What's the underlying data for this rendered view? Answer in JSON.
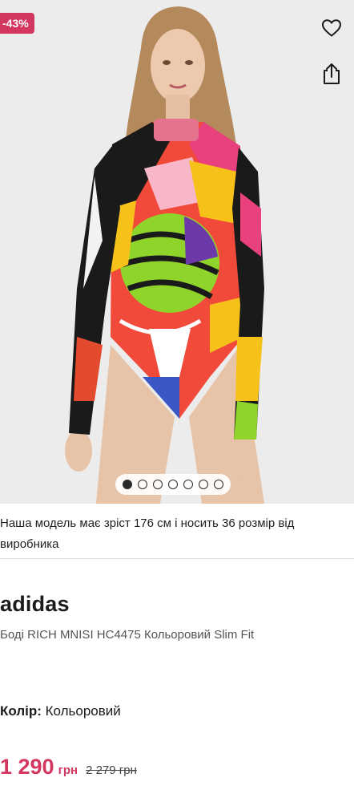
{
  "product": {
    "discount": "-43%",
    "gallery": {
      "slides": 7,
      "active_index": 0
    },
    "model_note": "Наша модель має зріст 176 см і носить 36 розмір від виробника",
    "brand": "adidas",
    "name": "Боді RICH MNISI HC4475 Кольоровий Slim Fit",
    "color_label": "Колір:",
    "color_value": "Кольоровий",
    "price_current": "1 290",
    "price_currency": "грн",
    "price_old": "2 279 грн"
  },
  "icons": {
    "wishlist": "heart-icon",
    "share": "share-icon"
  },
  "colors": {
    "accent": "#d3365f",
    "hero_bg": "#ececec"
  }
}
